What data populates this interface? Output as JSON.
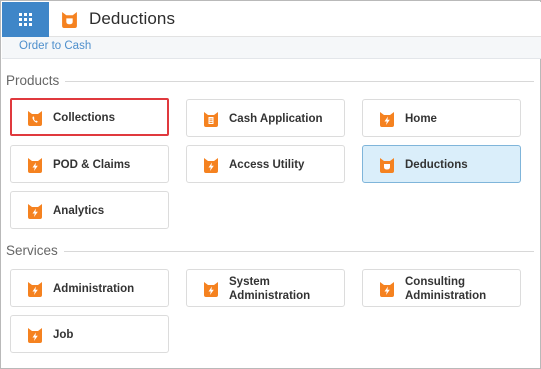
{
  "app": {
    "title": "Deductions"
  },
  "subnav": {
    "link": "Order to Cash"
  },
  "sections": {
    "products": "Products",
    "services": "Services"
  },
  "products": [
    {
      "label": "Collections",
      "icon": "phone-badge-icon"
    },
    {
      "label": "Cash Application",
      "icon": "document-badge-icon"
    },
    {
      "label": "Home",
      "icon": "lightning-badge-icon"
    },
    {
      "label": "POD & Claims",
      "icon": "lightning-badge-icon"
    },
    {
      "label": "Access Utility",
      "icon": "lightning-badge-icon"
    },
    {
      "label": "Deductions",
      "icon": "pocket-badge-icon"
    },
    {
      "label": "Analytics",
      "icon": "lightning-badge-icon"
    }
  ],
  "services": [
    {
      "label": "Administration",
      "icon": "lightning-badge-icon"
    },
    {
      "label_line1": "System",
      "label_line2": "Administration",
      "icon": "lightning-badge-icon"
    },
    {
      "label_line1": "Consulting",
      "label_line2": "Administration",
      "icon": "lightning-badge-icon"
    },
    {
      "label": "Job",
      "icon": "lightning-badge-icon"
    }
  ],
  "colors": {
    "brand_orange": "#f58220",
    "accent_blue": "#3f86c8",
    "active_tile_bg": "#daeefa",
    "highlight_border": "#e0393e"
  }
}
